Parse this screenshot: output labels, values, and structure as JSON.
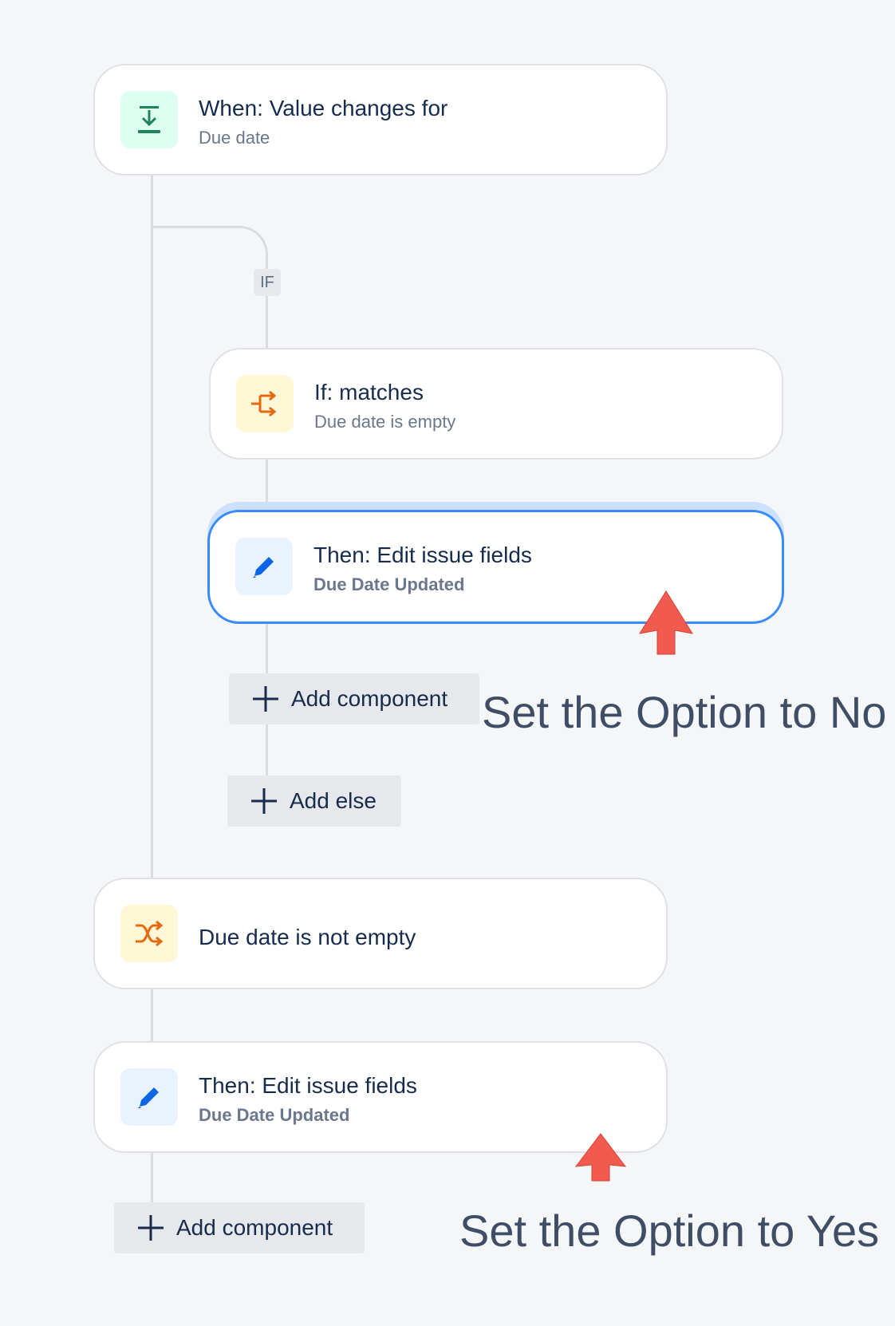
{
  "trigger": {
    "title": "When: Value changes for",
    "subtitle": "Due date"
  },
  "branch_tag": "IF",
  "condition": {
    "title": "If: matches",
    "subtitle": "Due date is empty"
  },
  "action_if": {
    "title": "Then: Edit issue fields",
    "subtitle": "Due Date Updated"
  },
  "add_component_inner": "Add component",
  "add_else": "Add else",
  "annotation_no": "Set the Option to No",
  "else_condition": {
    "title": "Due date is not empty"
  },
  "action_else": {
    "title": "Then: Edit issue fields",
    "subtitle": "Due Date Updated"
  },
  "add_component_outer": "Add component",
  "annotation_yes": "Set the Option to Yes",
  "colors": {
    "trigger_icon_bg": "#dcfff1",
    "trigger_icon": "#1f845a",
    "condition_icon_bg": "#fff7d6",
    "condition_icon": "#e56910",
    "action_icon_bg": "#e9f2ff",
    "action_icon": "#0c66e4",
    "selected_border": "#388bff",
    "annotation_arrow": "#f15b4f"
  },
  "icons": {
    "trigger": "download-arrow-icon",
    "condition": "branch-arrow-icon",
    "else_condition": "shuffle-icon",
    "action": "pencil-icon",
    "add": "plus-icon"
  }
}
